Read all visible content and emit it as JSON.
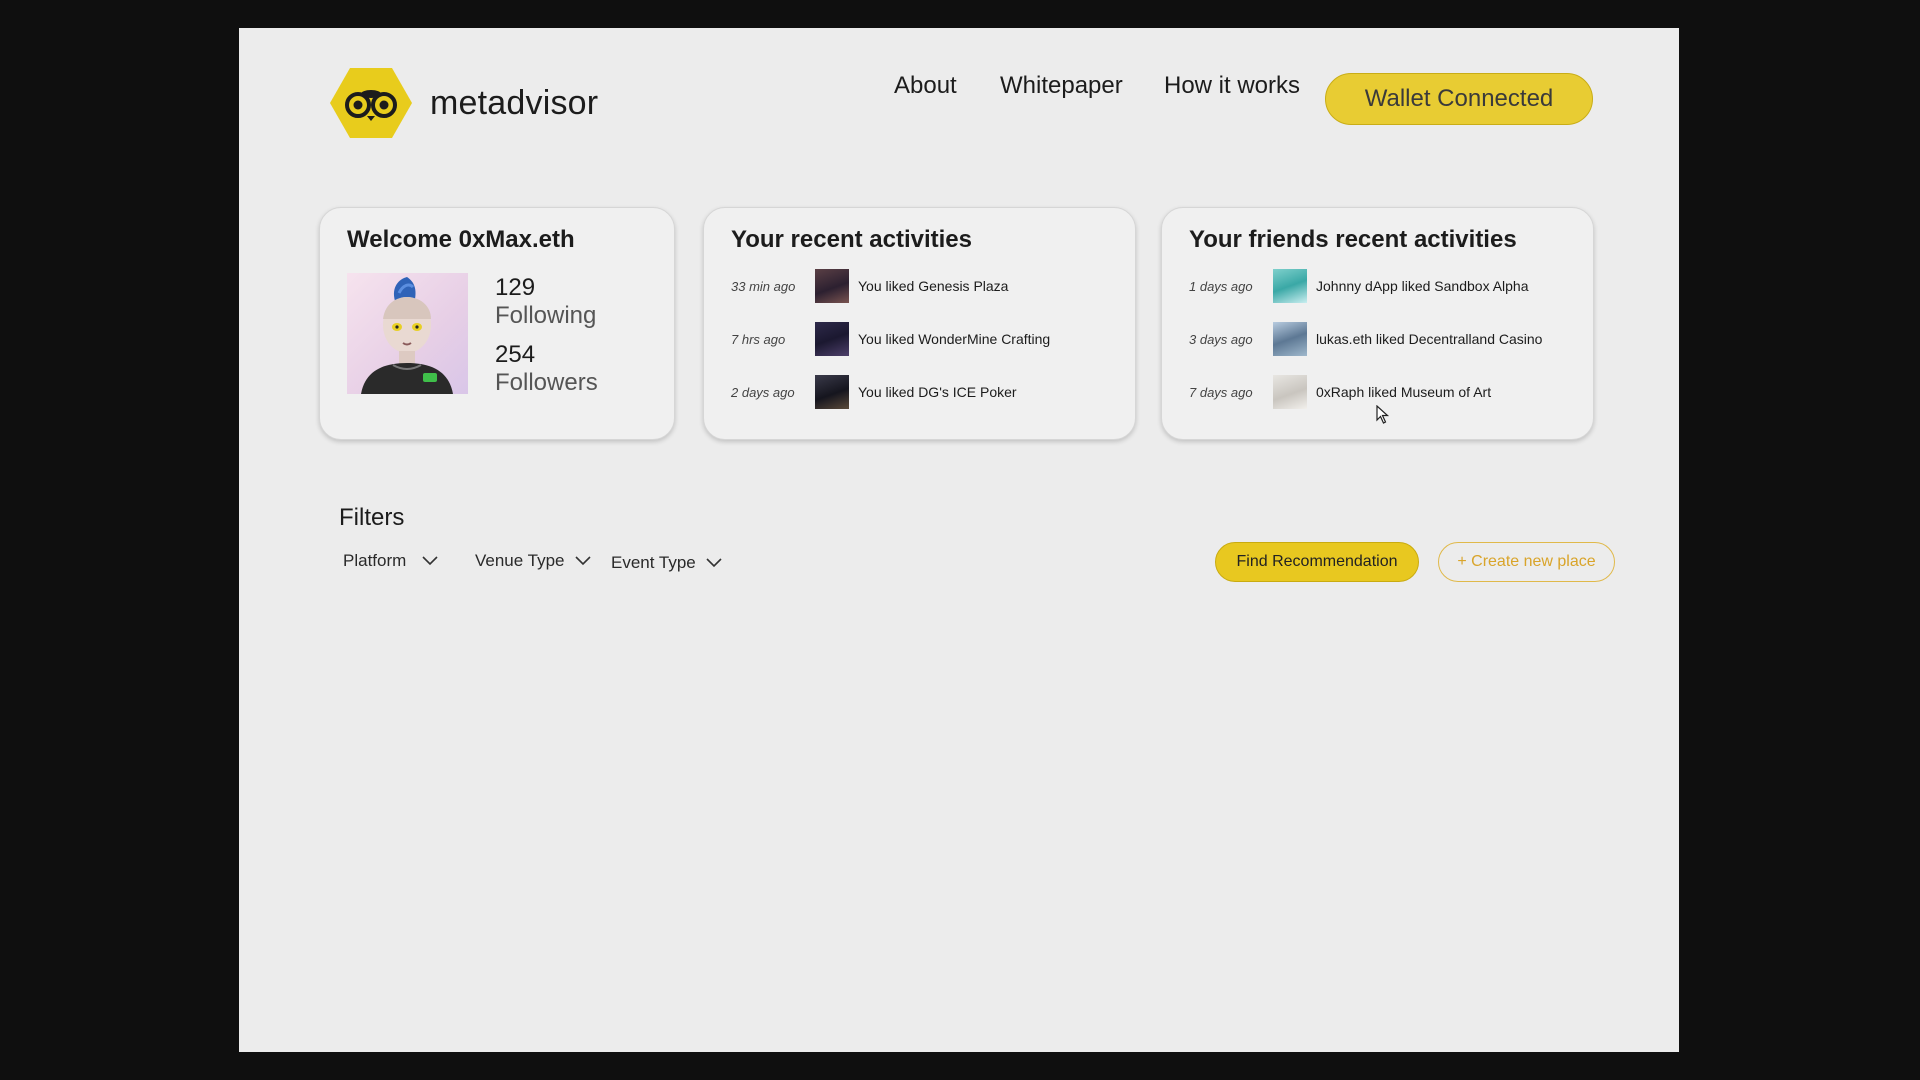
{
  "brand": {
    "name": "metadvisor",
    "accent": "#e8cc33"
  },
  "nav": {
    "items": [
      {
        "label": "About"
      },
      {
        "label": "Whitepaper"
      },
      {
        "label": "How it works"
      }
    ],
    "wallet_label": "Wallet Connected"
  },
  "welcome": {
    "title": "Welcome 0xMax.eth",
    "following_count": "129",
    "following_label": "Following",
    "followers_count": "254",
    "followers_label": "Followers"
  },
  "recent": {
    "title": "Your recent activities",
    "items": [
      {
        "time": "33 min ago",
        "text": "You liked Genesis Plaza"
      },
      {
        "time": "7 hrs ago",
        "text": "You liked WonderMine Crafting"
      },
      {
        "time": "2 days ago",
        "text": "You liked DG's ICE Poker"
      }
    ]
  },
  "friends": {
    "title": "Your friends recent activities",
    "items": [
      {
        "time": "1 days ago",
        "text": "Johnny dApp liked Sandbox Alpha"
      },
      {
        "time": "3 days ago",
        "text": "lukas.eth liked Decentralland Casino"
      },
      {
        "time": "7 days ago",
        "text": "0xRaph liked Museum of Art"
      }
    ]
  },
  "filters": {
    "title": "Filters",
    "dropdowns": [
      {
        "label": "Platform"
      },
      {
        "label": "Venue Type"
      },
      {
        "label": "Event Type"
      }
    ],
    "find_label": "Find Recommendation",
    "create_label": "+ Create new place"
  }
}
